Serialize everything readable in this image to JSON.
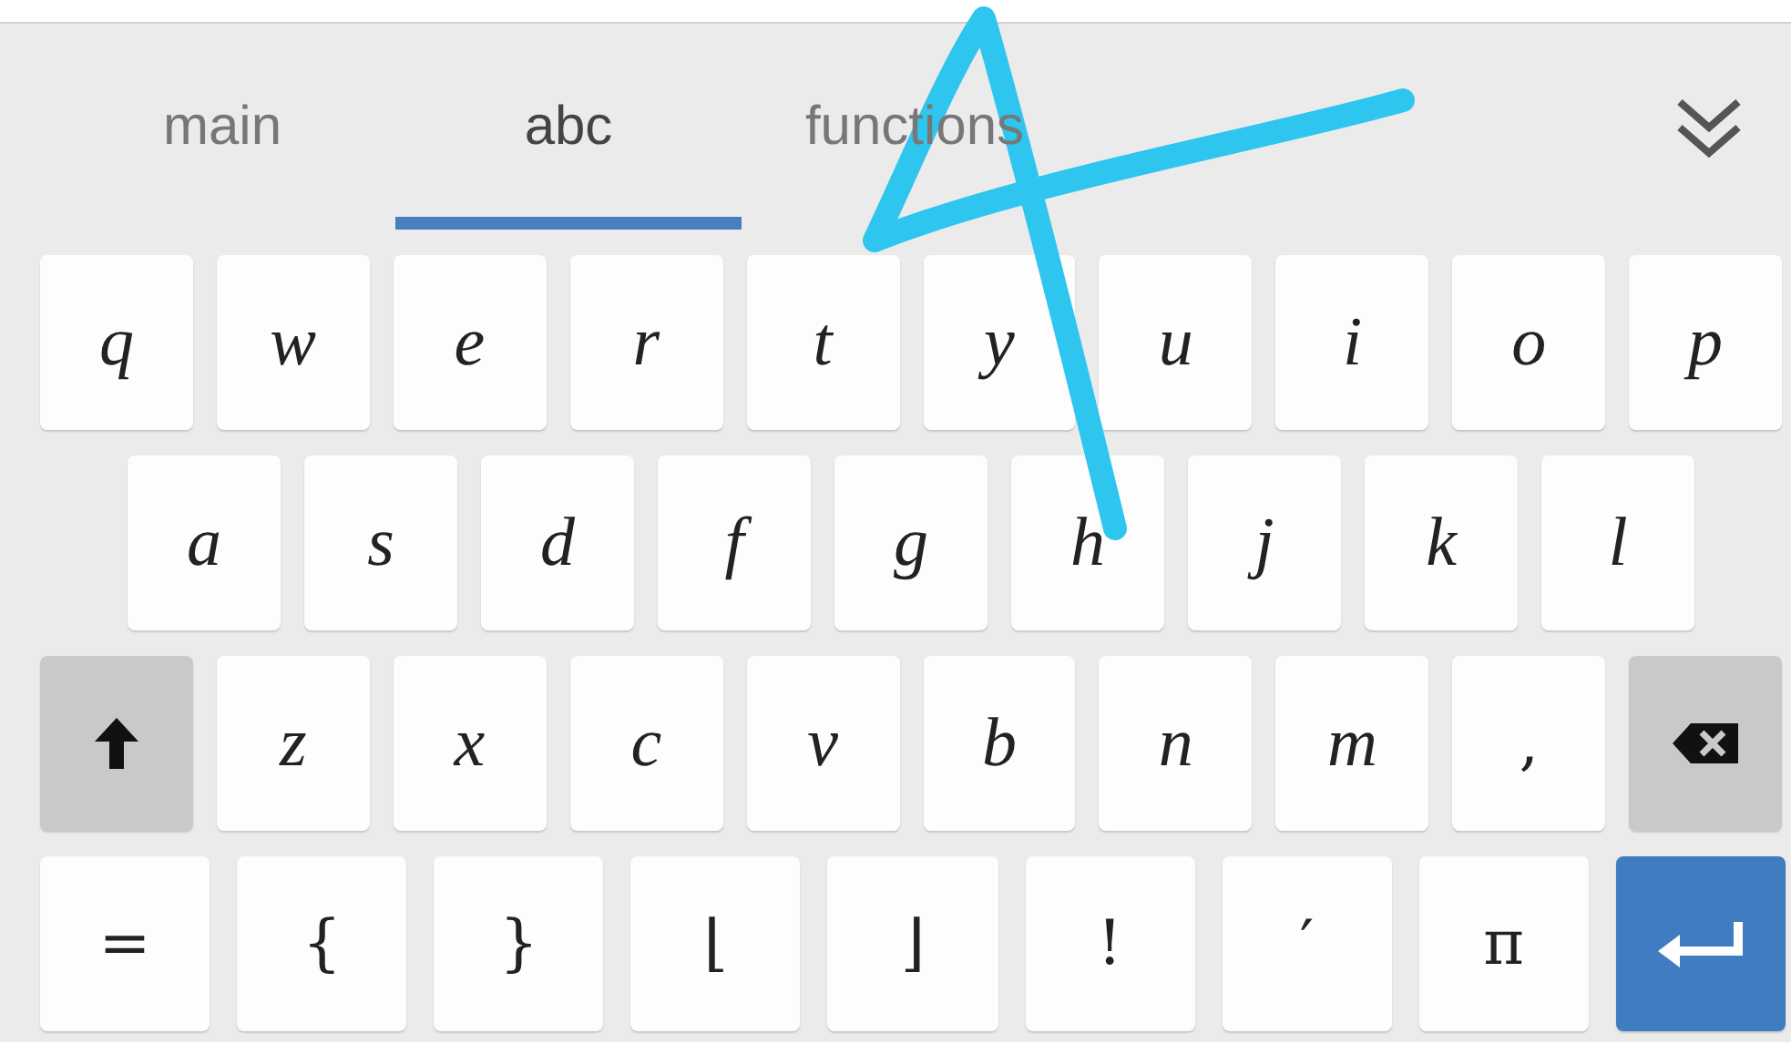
{
  "tabs": [
    {
      "label": "main",
      "selected": false
    },
    {
      "label": "abc",
      "selected": true
    },
    {
      "label": "functions",
      "selected": false
    }
  ],
  "rows": [
    [
      {
        "kind": "letter",
        "label": "q"
      },
      {
        "kind": "letter",
        "label": "w"
      },
      {
        "kind": "letter",
        "label": "e"
      },
      {
        "kind": "letter",
        "label": "r"
      },
      {
        "kind": "letter",
        "label": "t"
      },
      {
        "kind": "letter",
        "label": "y"
      },
      {
        "kind": "letter",
        "label": "u"
      },
      {
        "kind": "letter",
        "label": "i"
      },
      {
        "kind": "letter",
        "label": "o"
      },
      {
        "kind": "letter",
        "label": "p"
      }
    ],
    [
      {
        "kind": "letter",
        "label": "a"
      },
      {
        "kind": "letter",
        "label": "s"
      },
      {
        "kind": "letter",
        "label": "d"
      },
      {
        "kind": "letter",
        "label": "f"
      },
      {
        "kind": "letter",
        "label": "g"
      },
      {
        "kind": "letter",
        "label": "h"
      },
      {
        "kind": "letter",
        "label": "j"
      },
      {
        "kind": "letter",
        "label": "k"
      },
      {
        "kind": "letter",
        "label": "l"
      }
    ],
    [
      {
        "kind": "shift"
      },
      {
        "kind": "letter",
        "label": "z"
      },
      {
        "kind": "letter",
        "label": "x"
      },
      {
        "kind": "letter",
        "label": "c"
      },
      {
        "kind": "letter",
        "label": "v"
      },
      {
        "kind": "letter",
        "label": "b"
      },
      {
        "kind": "letter",
        "label": "n"
      },
      {
        "kind": "letter",
        "label": "m"
      },
      {
        "kind": "symbol",
        "label": ","
      },
      {
        "kind": "backspace"
      }
    ],
    [
      {
        "kind": "symbol",
        "label": "="
      },
      {
        "kind": "symbol",
        "label": "{"
      },
      {
        "kind": "symbol",
        "label": "}"
      },
      {
        "kind": "symbol",
        "label": "⌊"
      },
      {
        "kind": "symbol",
        "label": "⌋"
      },
      {
        "kind": "symbol",
        "label": "!"
      },
      {
        "kind": "symbol",
        "label": "′"
      },
      {
        "kind": "symbol",
        "label": "π"
      },
      {
        "kind": "enter"
      }
    ]
  ]
}
